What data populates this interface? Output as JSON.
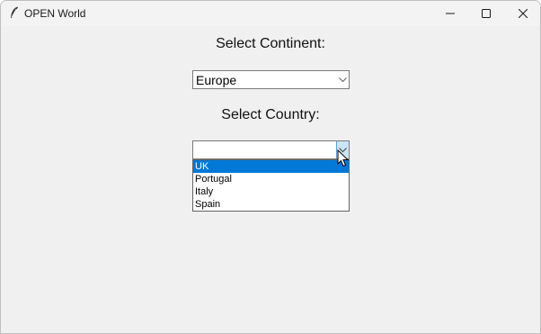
{
  "window": {
    "title": "OPEN World",
    "app_icon": "feather-icon",
    "controls": [
      "minimize-icon",
      "maximize-icon",
      "close-icon"
    ]
  },
  "continent": {
    "heading": "Select Continent:",
    "selected": "Europe"
  },
  "country": {
    "heading": "Select Country:",
    "selected": "",
    "options": [
      "UK",
      "Portugal",
      "Italy",
      "Spain"
    ],
    "highlighted": "UK"
  },
  "colors": {
    "selection_highlight": "#0078d7",
    "window_background": "#f0f0f0"
  }
}
